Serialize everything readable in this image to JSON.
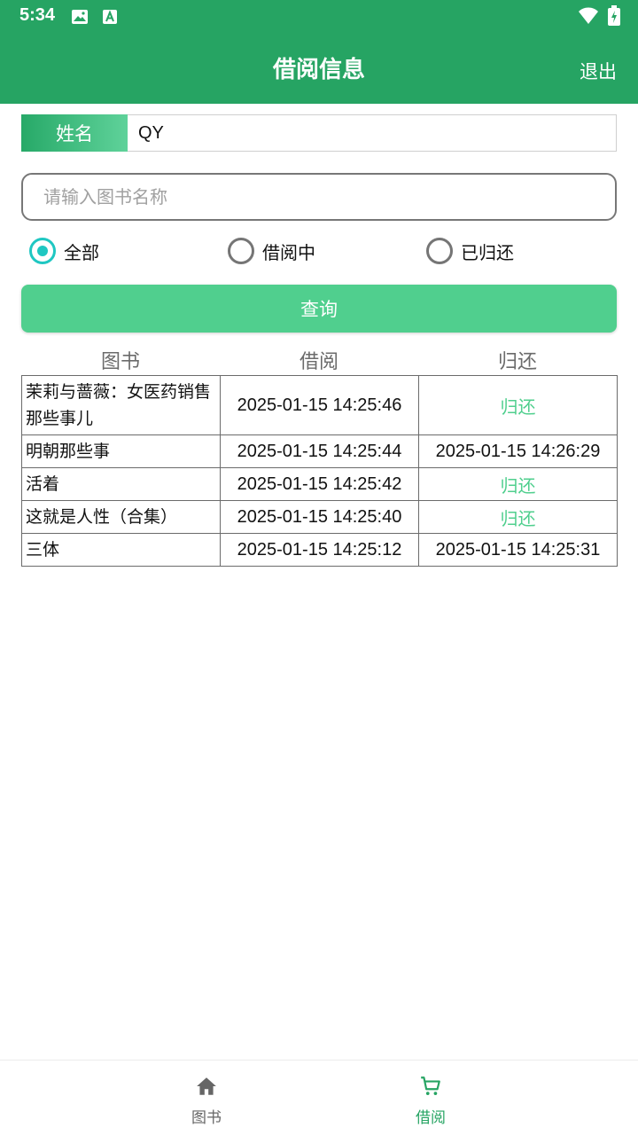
{
  "status_bar": {
    "time": "5:34"
  },
  "app_bar": {
    "title": "借阅信息",
    "logout_label": "退出"
  },
  "name_field": {
    "label": "姓名",
    "value": "QY"
  },
  "search": {
    "placeholder": "请输入图书名称",
    "value": ""
  },
  "filters": {
    "options": [
      {
        "label": "全部",
        "checked": true
      },
      {
        "label": "借阅中",
        "checked": false
      },
      {
        "label": "已归还",
        "checked": false
      }
    ]
  },
  "query_button": {
    "label": "查询"
  },
  "table": {
    "headers": [
      "图书",
      "借阅",
      "归还"
    ],
    "rows": [
      {
        "book": "茉莉与蔷薇：女医药销售那些事儿",
        "borrowed": "2025-01-15 14:25:46",
        "returned": "归还"
      },
      {
        "book": "明朝那些事",
        "borrowed": "2025-01-15 14:25:44",
        "returned": "2025-01-15 14:26:29"
      },
      {
        "book": "活着",
        "borrowed": "2025-01-15 14:25:42",
        "returned": "归还"
      },
      {
        "book": "这就是人性（合集）",
        "borrowed": "2025-01-15 14:25:40",
        "returned": "归还"
      },
      {
        "book": "三体",
        "borrowed": "2025-01-15 14:25:12",
        "returned": "2025-01-15 14:25:31"
      }
    ]
  },
  "bottom_nav": {
    "items": [
      {
        "label": "图书",
        "icon": "home-icon",
        "active": false
      },
      {
        "label": "借阅",
        "icon": "cart-icon",
        "active": true
      }
    ]
  },
  "colors": {
    "primary": "#26a463",
    "accent": "#50cf8e",
    "radio": "#1fc7c2"
  }
}
